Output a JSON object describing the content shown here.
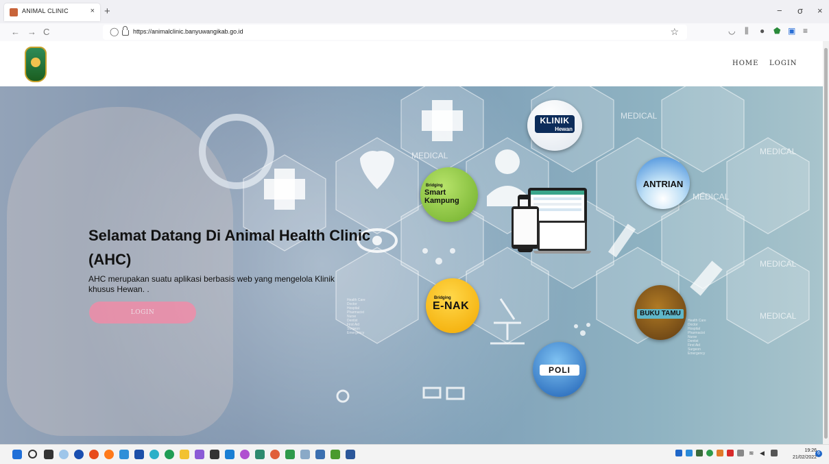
{
  "browser": {
    "tab_title": "ANIMAL CLINIC",
    "tab_close": "×",
    "new_tab": "+",
    "back": "←",
    "forward": "→",
    "reload": "C",
    "url": "https://animalclinic.banyuwangikab.go.id",
    "window_controls": [
      "−",
      "σ",
      "×"
    ]
  },
  "site_nav": {
    "home": "HOME",
    "login": "LOGIN"
  },
  "hero": {
    "title": "Selamat Datang Di Animal Health Clinic (AHC)",
    "description": "AHC merupakan suatu aplikasi berbasis web yang mengelola Klinik khusus Hewan. .",
    "login_button": "LOGIN",
    "background_labels": [
      "MEDICAL",
      "MEDICAL",
      "MEDICAL",
      "MEDICAL",
      "MEDICAL",
      "MEDICAL"
    ],
    "background_list_left": "Health Care\nDoctor\nHospital\nPharmacist\nNurse\nDentist\nFirst Aid\nSurgeon\nEmergency",
    "background_list_right": "Health Care\nDoctor\nHospital\nPharmacist\nNurse\nDentist\nFirst Aid\nSurgeon\nEmergency"
  },
  "menu_bubbles": {
    "klinik": {
      "title": "KLINIK",
      "sub": "Hewan"
    },
    "antrian": {
      "title": "ANTRIAN"
    },
    "smart_kampung": {
      "prefix": "Bridging",
      "title": "Smart Kampung"
    },
    "enak": {
      "prefix": "Bridging",
      "title": "E-NAK"
    },
    "buku_tamu": {
      "title": "BUKU TAMU"
    },
    "poli": {
      "title": "POLI"
    }
  },
  "taskbar": {
    "time": "19:26",
    "date": "21/02/2022",
    "notification_count": "6"
  },
  "colors": {
    "login_button": "#f08ca8",
    "klinik_bubble": "#ffffff",
    "antrian_bubble": "#4a90d9",
    "smart_kampung_bubble": "#8cc63f",
    "enak_bubble": "#f5b800",
    "buku_tamu_bubble": "#7a4a1e",
    "poli_bubble": "#2f7fd6"
  }
}
